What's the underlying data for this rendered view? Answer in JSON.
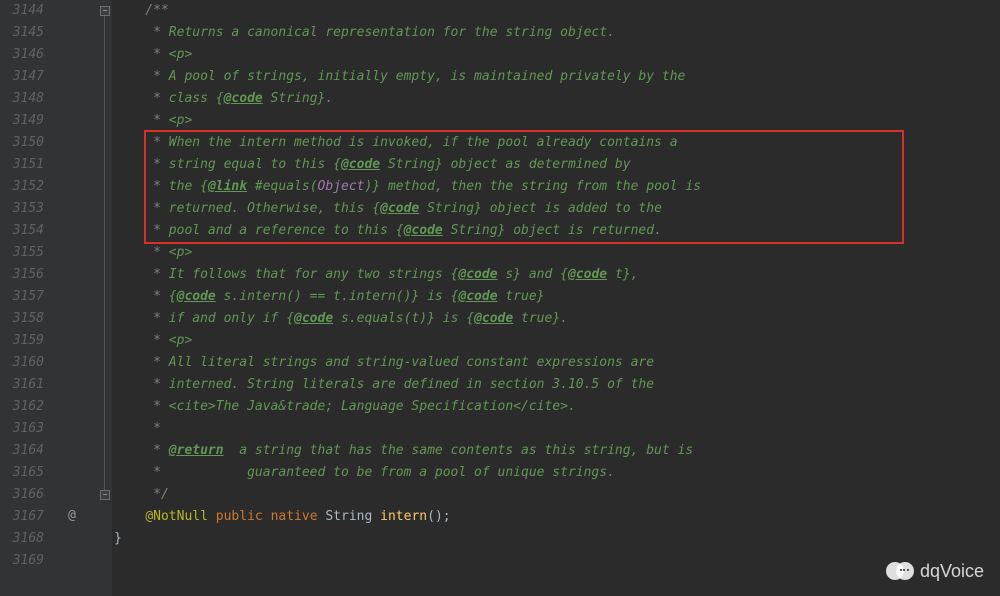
{
  "gutter": {
    "start": 3144,
    "end": 3169,
    "annotation_line": 3167,
    "annotation_symbol": "@",
    "fold_top_line": 3144,
    "fold_bottom_line": 3166
  },
  "highlight": {
    "from_line": 3150,
    "to_line": 3154
  },
  "code": {
    "3144": [
      [
        "cm",
        "    /**"
      ]
    ],
    "3145": [
      [
        "cm",
        "     * "
      ],
      [
        "cm-text",
        "Returns a canonical representation for the string object."
      ]
    ],
    "3146": [
      [
        "cm",
        "     * "
      ],
      [
        "cm-text",
        "<p>"
      ]
    ],
    "3147": [
      [
        "cm",
        "     * "
      ],
      [
        "cm-text",
        "A pool of strings, initially empty, is maintained privately by the"
      ]
    ],
    "3148": [
      [
        "cm",
        "     * "
      ],
      [
        "cm-text",
        "class {"
      ],
      [
        "cm-tag",
        "@code"
      ],
      [
        "cm-text",
        " String}."
      ]
    ],
    "3149": [
      [
        "cm",
        "     * "
      ],
      [
        "cm-text",
        "<p>"
      ]
    ],
    "3150": [
      [
        "cm",
        "     * "
      ],
      [
        "cm-text",
        "When the intern method is invoked, if the pool already contains a"
      ]
    ],
    "3151": [
      [
        "cm",
        "     * "
      ],
      [
        "cm-text",
        "string equal to this {"
      ],
      [
        "cm-tag",
        "@code"
      ],
      [
        "cm-text",
        " String} object as determined by"
      ]
    ],
    "3152": [
      [
        "cm",
        "     * "
      ],
      [
        "cm-text",
        "the {"
      ],
      [
        "cm-tag",
        "@link"
      ],
      [
        "cm-text",
        " #equals("
      ],
      [
        "cm-ref",
        "Object"
      ],
      [
        "cm-text",
        ")} method, then the string from the pool is"
      ]
    ],
    "3153": [
      [
        "cm",
        "     * "
      ],
      [
        "cm-text",
        "returned. Otherwise, this {"
      ],
      [
        "cm-tag",
        "@code"
      ],
      [
        "cm-text",
        " String} object is added to the"
      ]
    ],
    "3154": [
      [
        "cm",
        "     * "
      ],
      [
        "cm-text",
        "pool and a reference to this {"
      ],
      [
        "cm-tag",
        "@code"
      ],
      [
        "cm-text",
        " String} object is returned."
      ]
    ],
    "3155": [
      [
        "cm",
        "     * "
      ],
      [
        "cm-text",
        "<p>"
      ]
    ],
    "3156": [
      [
        "cm",
        "     * "
      ],
      [
        "cm-text",
        "It follows that for any two strings {"
      ],
      [
        "cm-tag",
        "@code"
      ],
      [
        "cm-text",
        " s} and {"
      ],
      [
        "cm-tag",
        "@code"
      ],
      [
        "cm-text",
        " t},"
      ]
    ],
    "3157": [
      [
        "cm",
        "     * "
      ],
      [
        "cm-text",
        "{"
      ],
      [
        "cm-tag",
        "@code"
      ],
      [
        "cm-text",
        " s.intern() == t.intern()} is {"
      ],
      [
        "cm-tag",
        "@code"
      ],
      [
        "cm-text",
        " true}"
      ]
    ],
    "3158": [
      [
        "cm",
        "     * "
      ],
      [
        "cm-text",
        "if and only if {"
      ],
      [
        "cm-tag",
        "@code"
      ],
      [
        "cm-text",
        " s.equals(t)} is {"
      ],
      [
        "cm-tag",
        "@code"
      ],
      [
        "cm-text",
        " true}."
      ]
    ],
    "3159": [
      [
        "cm",
        "     * "
      ],
      [
        "cm-text",
        "<p>"
      ]
    ],
    "3160": [
      [
        "cm",
        "     * "
      ],
      [
        "cm-text",
        "All literal strings and string-valued constant expressions are"
      ]
    ],
    "3161": [
      [
        "cm",
        "     * "
      ],
      [
        "cm-text",
        "interned. String literals are defined in section 3.10.5 of the"
      ]
    ],
    "3162": [
      [
        "cm",
        "     * "
      ],
      [
        "cm-text",
        "<cite>The Java&trade; Language Specification</cite>."
      ]
    ],
    "3163": [
      [
        "cm",
        "     *"
      ]
    ],
    "3164": [
      [
        "cm",
        "     * "
      ],
      [
        "cm-tag",
        "@return"
      ],
      [
        "cm-text",
        "  a string that has the same contents as this string, but is"
      ]
    ],
    "3165": [
      [
        "cm",
        "     *           "
      ],
      [
        "cm-text",
        "guaranteed to be from a pool of unique strings."
      ]
    ],
    "3166": [
      [
        "cm",
        "     */"
      ]
    ],
    "3167": [
      [
        "plain",
        "    "
      ],
      [
        "anno",
        "@NotNull"
      ],
      [
        "plain",
        " "
      ],
      [
        "kw",
        "public"
      ],
      [
        "plain",
        " "
      ],
      [
        "kw",
        "native"
      ],
      [
        "plain",
        " "
      ],
      [
        "type",
        "String"
      ],
      [
        "plain",
        " "
      ],
      [
        "method",
        "intern"
      ],
      [
        "plain",
        "();"
      ]
    ],
    "3168": [
      [
        "plain",
        "}"
      ]
    ],
    "3169": [
      [
        "plain",
        ""
      ]
    ]
  },
  "watermark": {
    "text": "dqVoice"
  }
}
